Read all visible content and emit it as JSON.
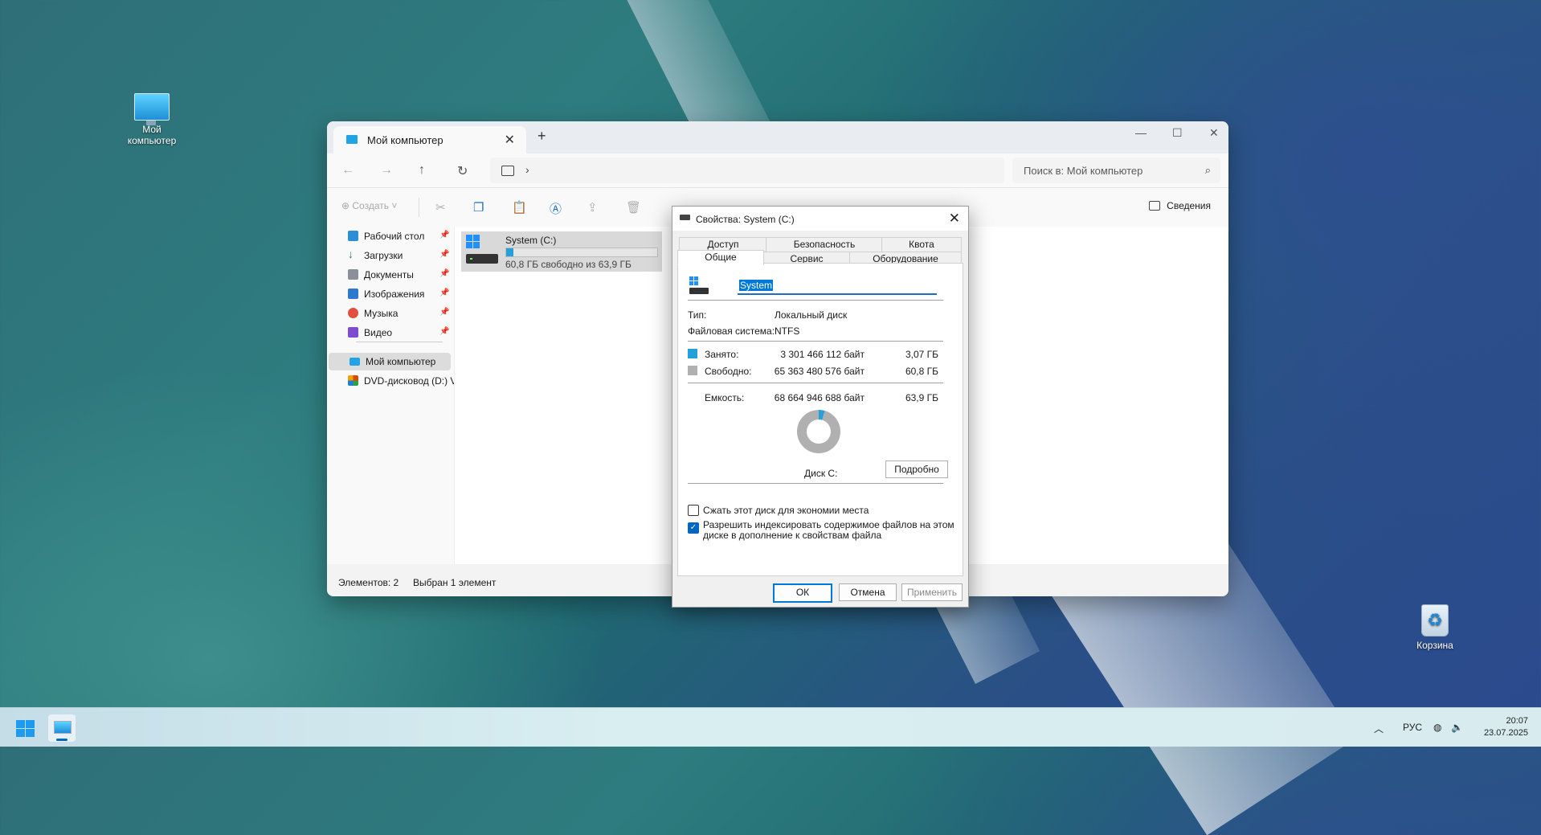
{
  "desktop": {
    "icons": [
      {
        "label": "Мой компьютер"
      },
      {
        "label": "Корзина"
      }
    ]
  },
  "explorer": {
    "tab_title": "Мой компьютер",
    "search_placeholder": "Поиск в: Мой компьютер",
    "toolbar": {
      "create_label": "Создать",
      "details_label": "Сведения"
    },
    "sidebar": {
      "items": [
        {
          "label": "Рабочий стол",
          "icon": "desktop-icon",
          "color": "#2a8fd6"
        },
        {
          "label": "Загрузки",
          "icon": "download-icon",
          "color": "#2d8a57"
        },
        {
          "label": "Документы",
          "icon": "document-icon",
          "color": "#8b8f99"
        },
        {
          "label": "Изображения",
          "icon": "pictures-icon",
          "color": "#2f78d1"
        },
        {
          "label": "Музыка",
          "icon": "music-icon",
          "color": "#e04f3f"
        },
        {
          "label": "Видео",
          "icon": "video-icon",
          "color": "#7e4bd3"
        },
        {
          "label": "Мой компьютер",
          "icon": "computer-icon",
          "color": "#22a3e6"
        },
        {
          "label": "DVD-дисковод (D:) V",
          "icon": "dvd-icon",
          "color": "#d9480f"
        }
      ]
    },
    "drive": {
      "name": "System (C:)",
      "space": "60,8 ГБ свободно из 63,9 ГБ",
      "used_fraction": 0.048
    },
    "status": {
      "count": "Элементов: 2",
      "selected": "Выбран 1 элемент"
    }
  },
  "dialog": {
    "title": "Свойства: System (C:)",
    "tabs_row1": [
      "Доступ",
      "Безопасность",
      "Квота"
    ],
    "tabs_row2": [
      "Общие",
      "Сервис",
      "Оборудование"
    ],
    "name_value": "System",
    "type_label": "Тип:",
    "type_value": "Локальный диск",
    "fs_label": "Файловая система:",
    "fs_value": "NTFS",
    "used_label": "Занято:",
    "used_bytes": "3 301 466 112 байт",
    "used_gb": "3,07 ГБ",
    "used_color": "#26a0da",
    "free_label": "Свободно:",
    "free_bytes": "65 363 480 576 байт",
    "free_gb": "60,8 ГБ",
    "free_color": "#b0b0b0",
    "cap_label": "Емкость:",
    "cap_bytes": "68 664 946 688 байт",
    "cap_gb": "63,9 ГБ",
    "disk_label": "Диск C:",
    "details_button": "Подробно",
    "compress_label": "Сжать этот диск для экономии места",
    "compress_checked": false,
    "index_label_1": "Разрешить индексировать содержимое файлов на этом",
    "index_label_2": "диске в дополнение к свойствам файла",
    "index_checked": true,
    "ok": "ОК",
    "cancel": "Отмена",
    "apply": "Применить"
  },
  "taskbar": {
    "lang": "РУС",
    "time": "20:07",
    "date": "23.07.2025"
  }
}
